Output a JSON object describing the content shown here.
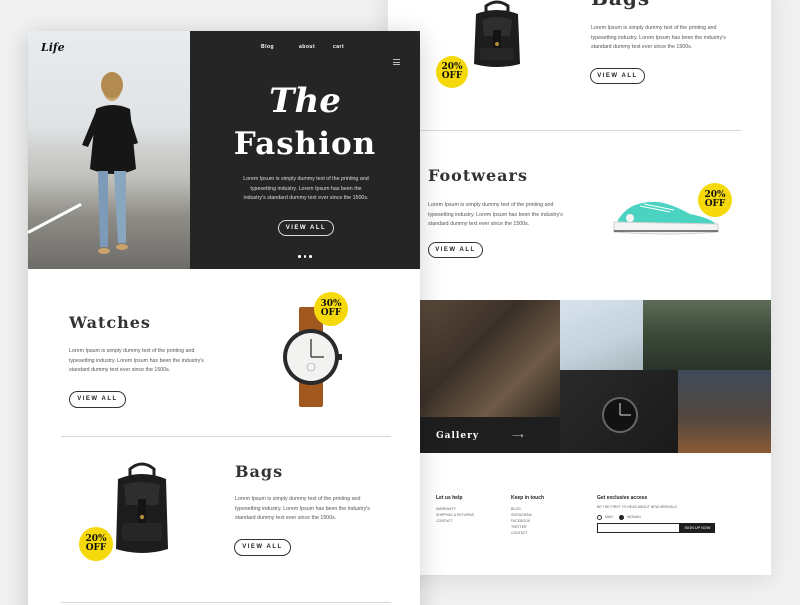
{
  "header": {
    "logo": "Life",
    "nav": [
      "Blog",
      "about",
      "cart"
    ]
  },
  "hero": {
    "title_top": "The",
    "title_main": "Fashion",
    "text": "Lorem Ipsum is simply dummy text of the printing and typesetting industry. Lorem Ipsum has been the industry's standard dummy text ever since the 1500s.",
    "button": "VIEW ALL"
  },
  "watches": {
    "title": "Watches",
    "text": "Lorem Ipsum is simply dummy text of the printing and typesetting industry. Lorem Ipsum has been the industry's standard dummy text ever since the 1500s.",
    "button": "VIEW ALL",
    "badge_pct": "30%",
    "badge_off": "OFF"
  },
  "bags": {
    "title": "Bags",
    "text": "Lorem Ipsum is simply dummy text of the printing and typesetting industry. Lorem Ipsum has been the industry's standard dummy text ever since the 1500s.",
    "button": "VIEW ALL",
    "badge_pct": "20%",
    "badge_off": "OFF"
  },
  "back_bags": {
    "title": "Bags",
    "text": "Lorem Ipsum is simply dummy text of the printing and typesetting industry. Lorem Ipsum has been the industry's standard dummy text ever since the 1500s.",
    "button": "VIEW ALL",
    "badge_pct": "20%",
    "badge_off": "OFF"
  },
  "footwears": {
    "title": "Footwears",
    "text": "Lorem Ipsum is simply dummy text of the printing and typesetting industry. Lorem Ipsum has been the industry's standard dummy text ever since the 1500s.",
    "button": "VIEW ALL",
    "badge_pct": "20%",
    "badge_off": "OFF"
  },
  "gallery": {
    "label": "Gallery"
  },
  "footer": {
    "col1_title": "Let us help",
    "col1_links": [
      "WARRANTY",
      "SHIPPING & RETURNS",
      "CONTACT"
    ],
    "col2_title": "Keep in touch",
    "col2_links": [
      "BLOG",
      "INSTAGRAM",
      "FACEBOOK",
      "TWITTER",
      "CONTACT"
    ],
    "col3_title": "Get exclusive access",
    "col3_sub": "BE THE FIRST TO HEAR ABOUT NEW ARRIVALS",
    "radio_1": "MAN",
    "radio_2": "WOMAN",
    "signup": "SIGN UP NOW"
  },
  "colors": {
    "accent_yellow": "#f5d90a",
    "hero_dark": "#262526",
    "teal": "#4ad3c1"
  }
}
